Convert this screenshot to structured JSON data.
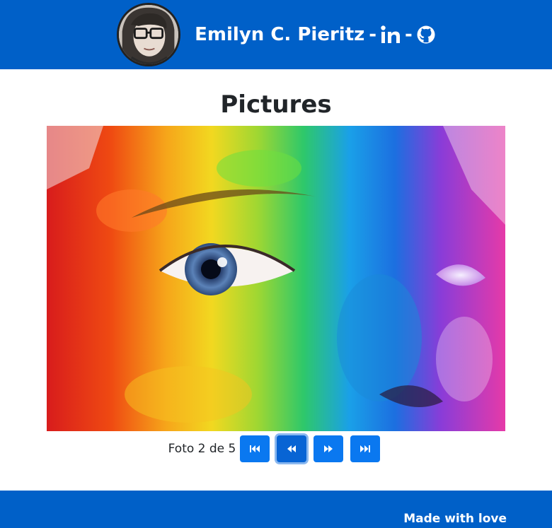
{
  "header": {
    "name": "Emilyn C. Pieritz",
    "separator": "-",
    "links": [
      "linkedin-icon",
      "github-icon"
    ]
  },
  "main": {
    "title": "Pictures",
    "pager": {
      "label": "Foto 2 de 5",
      "current": 2,
      "total": 5,
      "buttons": [
        "first-icon",
        "previous-icon",
        "next-icon",
        "last-icon"
      ]
    }
  },
  "footer": {
    "text": "Made with love"
  },
  "colors": {
    "brand_blue": "#0060c8",
    "button_blue": "#0a78f0"
  }
}
